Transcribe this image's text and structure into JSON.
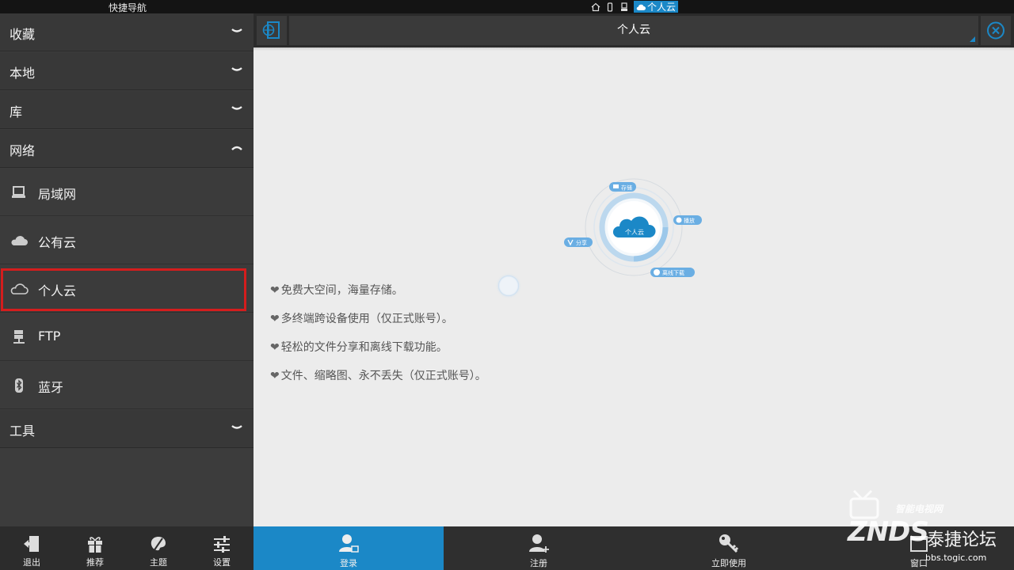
{
  "topbar": {
    "title": "快捷导航",
    "crumb_icons": [
      "home-icon",
      "phone-icon",
      "desktop-icon"
    ],
    "active_crumb": "个人云"
  },
  "sidebar": {
    "sections": [
      {
        "label": "收藏",
        "expanded": false
      },
      {
        "label": "本地",
        "expanded": false
      },
      {
        "label": "库",
        "expanded": false
      },
      {
        "label": "网络",
        "expanded": true
      },
      {
        "label": "工具",
        "expanded": false
      }
    ],
    "network_items": [
      {
        "label": "局域网",
        "icon": "computer-icon"
      },
      {
        "label": "公有云",
        "icon": "cloud-filled-icon"
      },
      {
        "label": "个人云",
        "icon": "cloud-outline-icon",
        "selected": true
      },
      {
        "label": "FTP",
        "icon": "ftp-server-icon"
      },
      {
        "label": "蓝牙",
        "icon": "bluetooth-icon"
      }
    ],
    "bottom": [
      {
        "label": "退出",
        "icon": "exit-icon"
      },
      {
        "label": "推荐",
        "icon": "gift-icon"
      },
      {
        "label": "主题",
        "icon": "palette-icon"
      },
      {
        "label": "设置",
        "icon": "sliders-icon"
      }
    ]
  },
  "main": {
    "title": "个人云",
    "diagram": {
      "center": "个人云",
      "labels": [
        "存储",
        "播放",
        "离线下载",
        "分享"
      ]
    },
    "features": [
      "免费大空间，海量存储。",
      "多终端跨设备使用（仅正式账号）。",
      "轻松的文件分享和离线下载功能。",
      "文件、缩略图、永不丢失（仅正式账号）。"
    ],
    "actions": [
      {
        "label": "登录",
        "icon": "login-user-icon",
        "active": true
      },
      {
        "label": "注册",
        "icon": "add-user-icon",
        "active": false
      },
      {
        "label": "立即使用",
        "icon": "key-icon",
        "active": false
      },
      {
        "label": "窗口",
        "icon": "window-icon",
        "active": false
      }
    ]
  },
  "watermark": {
    "brand": "ZNDS",
    "tagline": "智能电视网",
    "forum": "泰捷论坛",
    "url": "bbs.togic.com"
  },
  "colors": {
    "accent": "#1b88c7",
    "selection_border": "#d41d1d",
    "sidebar_bg": "#3c3c3c",
    "content_bg": "#ececec"
  }
}
